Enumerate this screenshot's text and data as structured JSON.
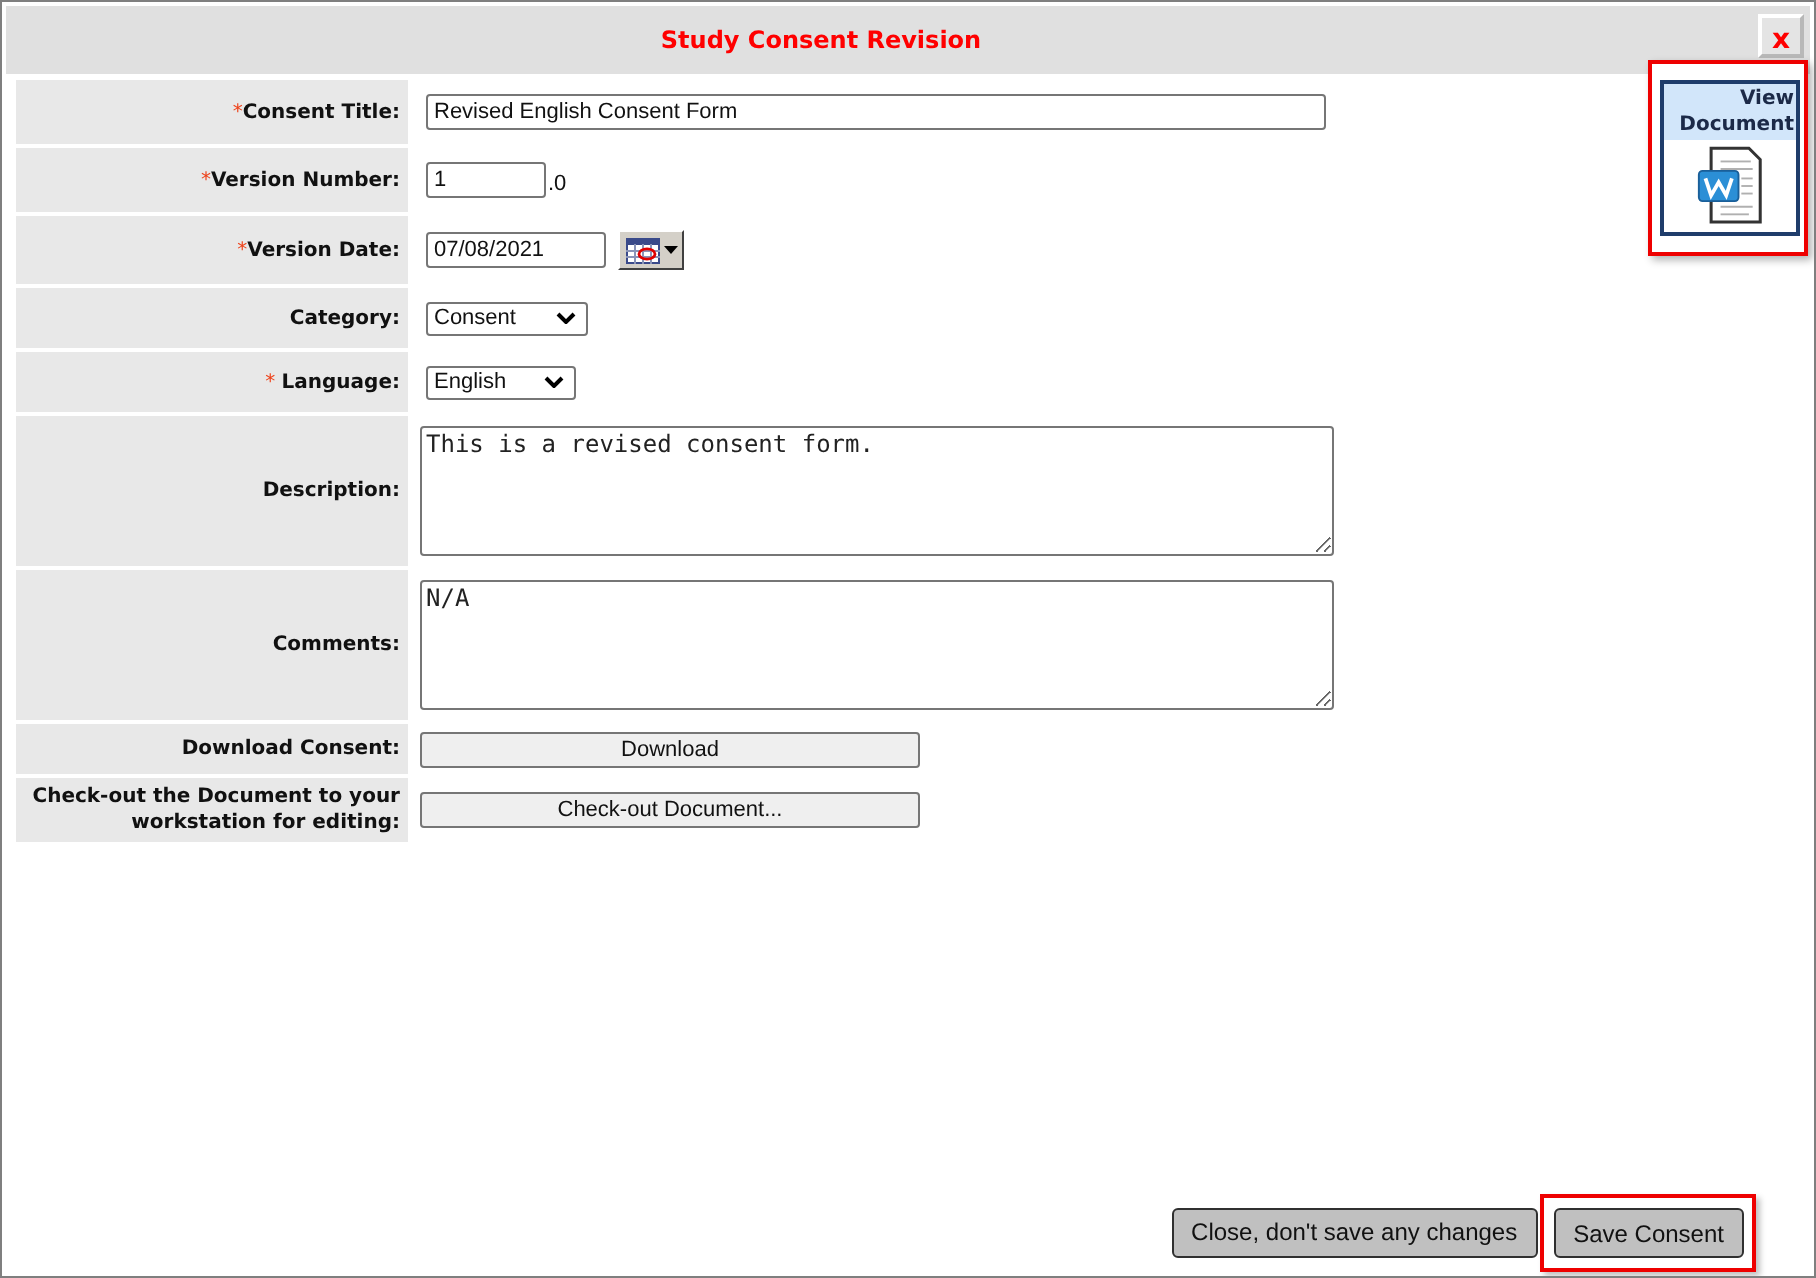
{
  "window": {
    "title": "Study Consent Revision",
    "close": "x"
  },
  "view_document": {
    "label": "View Document",
    "highlighted": true
  },
  "fields": [
    {
      "kind": "text",
      "label": "Consent Title:",
      "required_mark": "*",
      "value": "Revised English Consent Form"
    },
    {
      "kind": "text",
      "label": "Version Number:",
      "required_mark": "*",
      "value": "1",
      "suffix": ".0"
    },
    {
      "kind": "date",
      "label": "Version Date:",
      "required_mark": "*",
      "value": "07/08/2021"
    },
    {
      "kind": "select",
      "label": "Category:",
      "value": "Consent"
    },
    {
      "kind": "select",
      "label": "Language:",
      "required_mark": "* ",
      "value": "English"
    },
    {
      "kind": "textarea",
      "label": "Description:",
      "value": "This is a revised consent form."
    },
    {
      "kind": "textarea",
      "label": "Comments:",
      "value": "N/A"
    },
    {
      "kind": "button",
      "label": "Download Consent:",
      "button": "Download"
    },
    {
      "kind": "button",
      "label": "Check-out the Document to your workstation for editing:",
      "button": "Check-out Document..."
    }
  ],
  "footer_buttons": [
    {
      "label": "Close, don't save any changes",
      "highlighted": false
    },
    {
      "label": "Save Consent",
      "highlighted": true
    }
  ]
}
